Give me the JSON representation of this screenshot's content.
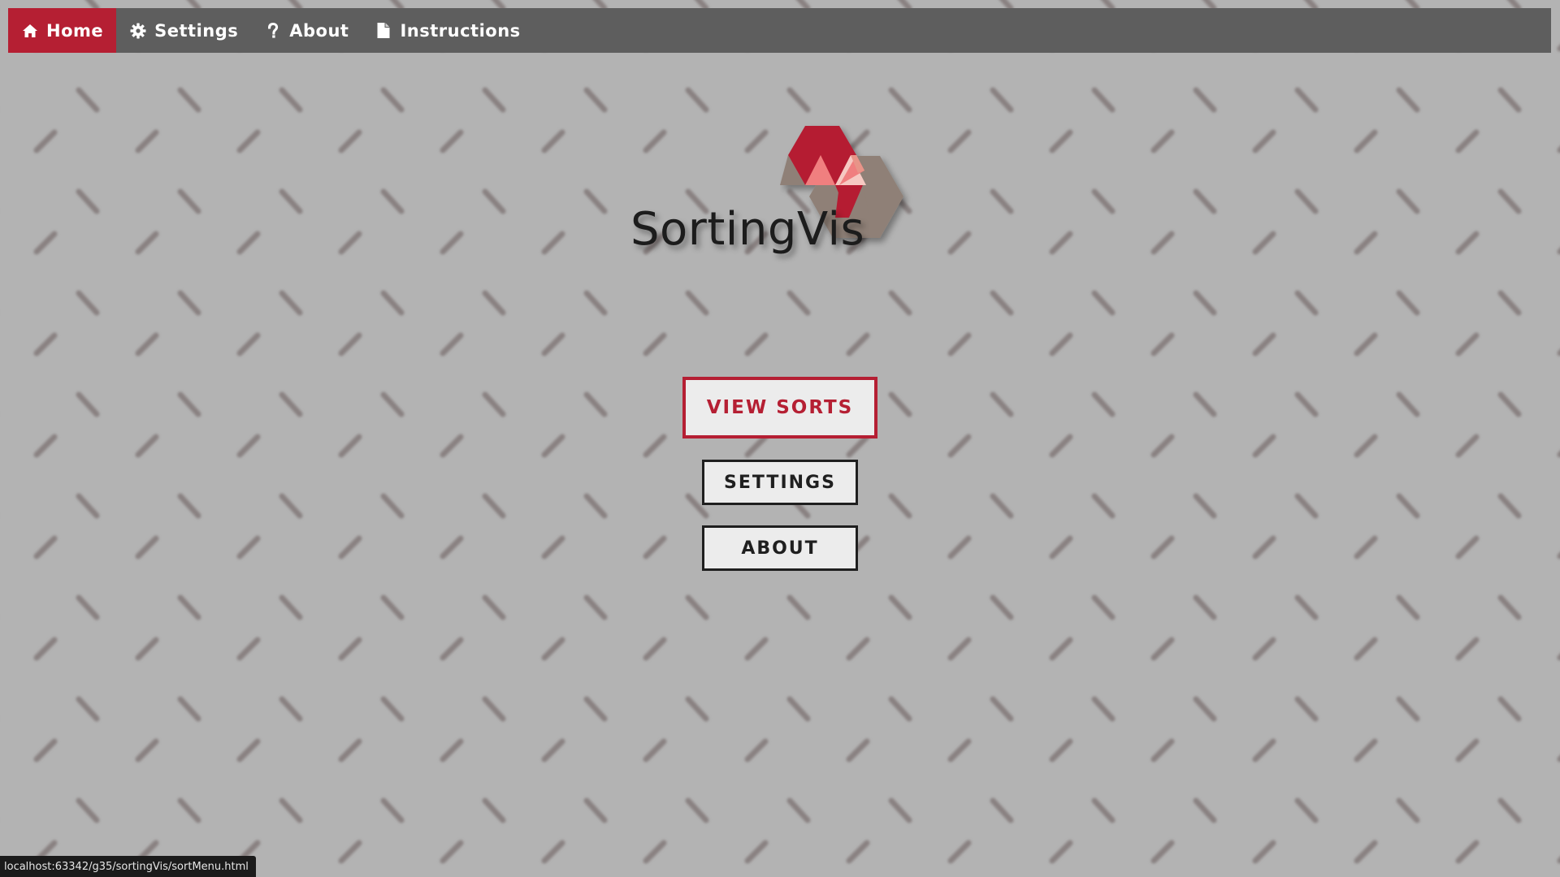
{
  "nav": {
    "items": [
      {
        "label": "Home",
        "icon": "home-icon",
        "active": true
      },
      {
        "label": "Settings",
        "icon": "gear-icon",
        "active": false
      },
      {
        "label": "About",
        "icon": "question-icon",
        "active": false
      },
      {
        "label": "Instructions",
        "icon": "document-icon",
        "active": false
      }
    ]
  },
  "logo": {
    "text": "SortingVis",
    "icon": "hexagon-logo-icon"
  },
  "menu": {
    "view_sorts_label": "VIEW SORTS",
    "settings_label": "SETTINGS",
    "about_label": "ABOUT"
  },
  "status": {
    "url": "localhost:63342/g35/sortingVis/sortMenu.html"
  },
  "colors": {
    "accent": "#b51f33",
    "navbar": "#5e5e5e",
    "background": "#b3b3b3",
    "button_bg": "#ececec",
    "hex_gray": "#8f8077",
    "hex_pink": "#f07f7f",
    "hex_light_pink": "#f6c9c2"
  }
}
